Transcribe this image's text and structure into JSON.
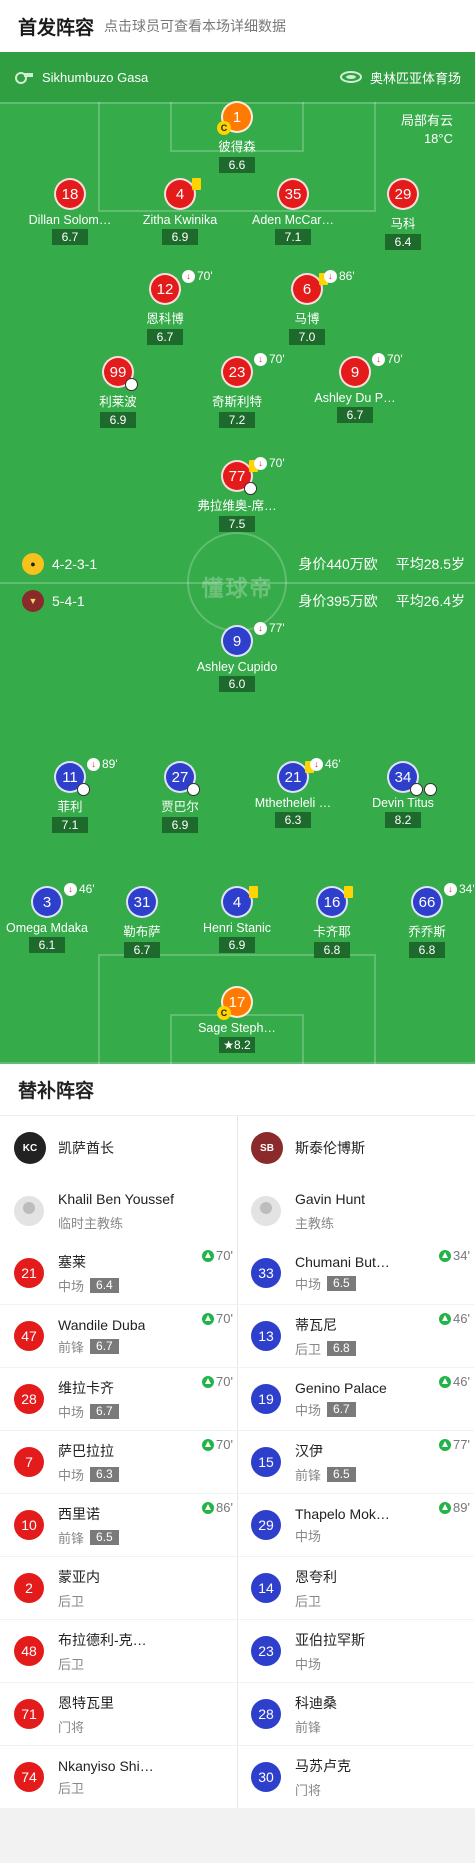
{
  "header": {
    "title": "首发阵容",
    "hint": "点击球员可查看本场详细数据"
  },
  "match": {
    "referee": "Sikhumbuzo Gasa",
    "venue": "奥林匹亚体育场",
    "weather": "局部有云",
    "temperature": "18°C",
    "watermark": "懂球帝"
  },
  "home_team": {
    "name": "凯萨酋长",
    "formation": "4-2-3-1",
    "value": "身价440万欧",
    "avg_age": "平均28.5岁",
    "color": "#e41b1b"
  },
  "away_team": {
    "name": "斯泰伦博斯",
    "formation": "5-4-1",
    "value": "身价395万欧",
    "avg_age": "平均26.4岁",
    "color": "#2e3fcc"
  },
  "home_players": [
    {
      "num": "1",
      "name": "彼得森",
      "rating": "6.6",
      "gk": true,
      "captain": true
    },
    {
      "num": "18",
      "name": "Dillan Solom…",
      "rating": "6.7"
    },
    {
      "num": "4",
      "name": "Zitha Kwinika",
      "rating": "6.9",
      "yellow": true
    },
    {
      "num": "35",
      "name": "Aden McCar…",
      "rating": "7.1"
    },
    {
      "num": "29",
      "name": "马科",
      "rating": "6.4"
    },
    {
      "num": "12",
      "name": "恩科博",
      "rating": "6.7",
      "sub": "70'"
    },
    {
      "num": "6",
      "name": "马博",
      "rating": "7.0",
      "yellow": true,
      "sub": "86'"
    },
    {
      "num": "99",
      "name": "利莱波",
      "rating": "6.9",
      "ball": true
    },
    {
      "num": "23",
      "name": "奇斯利特",
      "rating": "7.2",
      "sub": "70'"
    },
    {
      "num": "9",
      "name": "Ashley Du P…",
      "rating": "6.7",
      "sub": "70'"
    },
    {
      "num": "77",
      "name": "弗拉维奥-席…",
      "rating": "7.5",
      "yellow": true,
      "sub": "70'",
      "goal": true
    }
  ],
  "away_players": [
    {
      "num": "9",
      "name": "Ashley Cupido",
      "rating": "6.0",
      "sub": "77'"
    },
    {
      "num": "11",
      "name": "菲利",
      "rating": "7.1",
      "sub": "89'",
      "goal": true
    },
    {
      "num": "27",
      "name": "贾巴尔",
      "rating": "6.9",
      "ball": true
    },
    {
      "num": "21",
      "name": "Mthetheleli …",
      "rating": "6.3",
      "yellow": true,
      "sub": "46'"
    },
    {
      "num": "34",
      "name": "Devin Titus",
      "rating": "8.2",
      "goal": true,
      "ball": true
    },
    {
      "num": "3",
      "name": "Omega Mdaka",
      "rating": "6.1",
      "sub": "46'"
    },
    {
      "num": "31",
      "name": "勒布萨",
      "rating": "6.7"
    },
    {
      "num": "4",
      "name": "Henri Stanic",
      "rating": "6.9",
      "yellow": true
    },
    {
      "num": "16",
      "name": "卡齐耶",
      "rating": "6.8",
      "yellow": true
    },
    {
      "num": "66",
      "name": "乔乔斯",
      "rating": "6.8",
      "sub": "34'"
    },
    {
      "num": "17",
      "name": "Sage Steph…",
      "rating": "8.2",
      "gk": true,
      "captain": true,
      "best": true
    }
  ],
  "subs": {
    "title": "替补阵容",
    "home_coach": {
      "name": "Khalil Ben Youssef",
      "role": "临时主教练"
    },
    "away_coach": {
      "name": "Gavin Hunt",
      "role": "主教练"
    },
    "home": [
      {
        "num": "21",
        "name": "塞莱",
        "pos": "中场",
        "rating": "6.4",
        "on": "70'"
      },
      {
        "num": "47",
        "name": "Wandile Duba",
        "pos": "前锋",
        "rating": "6.7",
        "on": "70'"
      },
      {
        "num": "28",
        "name": "维拉卡齐",
        "pos": "中场",
        "rating": "6.7",
        "on": "70'"
      },
      {
        "num": "7",
        "name": "萨巴拉拉",
        "pos": "中场",
        "rating": "6.3",
        "on": "70'"
      },
      {
        "num": "10",
        "name": "西里诺",
        "pos": "前锋",
        "rating": "6.5",
        "on": "86'"
      },
      {
        "num": "2",
        "name": "蒙亚内",
        "pos": "后卫"
      },
      {
        "num": "48",
        "name": "布拉德利-克…",
        "pos": "后卫"
      },
      {
        "num": "71",
        "name": "恩特瓦里",
        "pos": "门将"
      },
      {
        "num": "74",
        "name": "Nkanyiso Shi…",
        "pos": "后卫"
      }
    ],
    "away": [
      {
        "num": "33",
        "name": "Chumani But…",
        "pos": "中场",
        "rating": "6.5",
        "on": "34'"
      },
      {
        "num": "13",
        "name": "蒂瓦尼",
        "pos": "后卫",
        "rating": "6.8",
        "on": "46'"
      },
      {
        "num": "19",
        "name": "Genino Palace",
        "pos": "中场",
        "rating": "6.7",
        "on": "46'"
      },
      {
        "num": "15",
        "name": "汉伊",
        "pos": "前锋",
        "rating": "6.5",
        "on": "77'"
      },
      {
        "num": "29",
        "name": "Thapelo Mok…",
        "pos": "中场",
        "on": "89'"
      },
      {
        "num": "14",
        "name": "恩夸利",
        "pos": "后卫"
      },
      {
        "num": "23",
        "name": "亚伯拉罕斯",
        "pos": "中场"
      },
      {
        "num": "28",
        "name": "科迪桑",
        "pos": "前锋"
      },
      {
        "num": "30",
        "name": "马苏卢克",
        "pos": "门将"
      }
    ]
  }
}
